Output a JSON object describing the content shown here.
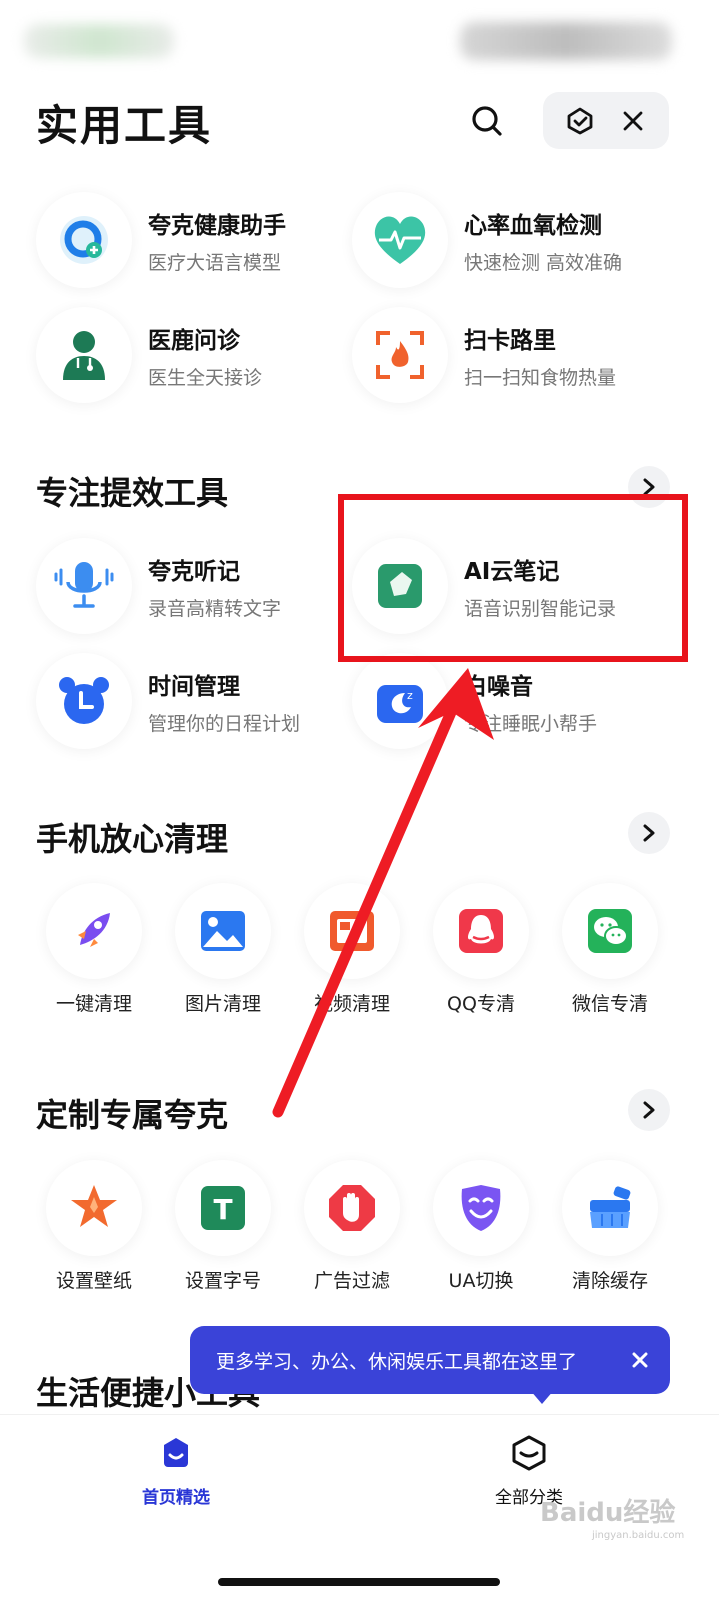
{
  "header": {
    "title": "实用工具"
  },
  "featured_tools": [
    {
      "name": "夸克健康助手",
      "desc": "医疗大语言模型",
      "icon": "health-assistant-icon"
    },
    {
      "name": "心率血氧检测",
      "desc": "快速检测 高效准确",
      "icon": "heart-rate-icon"
    },
    {
      "name": "医鹿问诊",
      "desc": "医生全天接诊",
      "icon": "doctor-icon"
    },
    {
      "name": "扫卡路里",
      "desc": "扫一扫知食物热量",
      "icon": "calorie-scan-icon"
    }
  ],
  "focus_section": {
    "title": "专注提效工具",
    "tools": [
      {
        "name": "夸克听记",
        "desc": "录音高精转文字",
        "icon": "microphone-icon"
      },
      {
        "name": "AI云笔记",
        "desc": "语音识别智能记录",
        "icon": "note-icon"
      },
      {
        "name": "时间管理",
        "desc": "管理你的日程计划",
        "icon": "alarm-clock-icon"
      },
      {
        "name": "白噪音",
        "desc": "专注睡眠小帮手",
        "icon": "white-noise-icon"
      }
    ]
  },
  "clean_section": {
    "title": "手机放心清理",
    "items": [
      {
        "label": "一键清理",
        "icon": "rocket-icon"
      },
      {
        "label": "图片清理",
        "icon": "image-icon"
      },
      {
        "label": "视频清理",
        "icon": "video-icon"
      },
      {
        "label": "QQ专清",
        "icon": "qq-icon"
      },
      {
        "label": "微信专清",
        "icon": "wechat-icon"
      }
    ]
  },
  "custom_section": {
    "title": "定制专属夸克",
    "items": [
      {
        "label": "设置壁纸",
        "icon": "wallpaper-icon"
      },
      {
        "label": "设置字号",
        "icon": "font-size-icon"
      },
      {
        "label": "广告过滤",
        "icon": "ad-block-icon"
      },
      {
        "label": "UA切换",
        "icon": "ua-switch-icon"
      },
      {
        "label": "清除缓存",
        "icon": "clear-cache-icon"
      }
    ]
  },
  "life_section": {
    "title": "生活便捷小工具"
  },
  "tooltip": {
    "text": "更多学习、办公、休闲娱乐工具都在这里了"
  },
  "tabbar": {
    "tabs": [
      {
        "label": "首页精选",
        "active": true
      },
      {
        "label": "全部分类",
        "active": false
      }
    ]
  },
  "watermark": {
    "text": "Baidu经验",
    "sub": "jingyan.baidu.com"
  },
  "colors": {
    "accent": "#3a43d8",
    "highlight": "#e8141c",
    "annotation_arrow": "#ee1c24"
  }
}
